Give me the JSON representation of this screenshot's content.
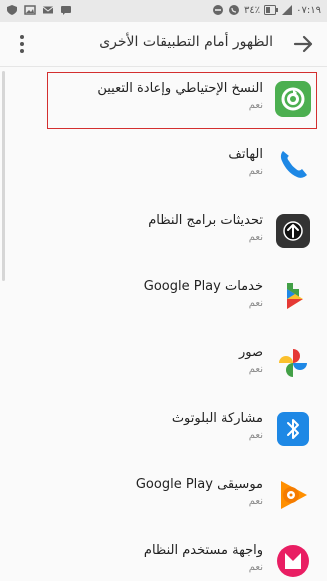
{
  "status_bar": {
    "time": "٠٧:١٩",
    "battery": "٣٤٪"
  },
  "app_bar": {
    "title": "الظهور أمام التطبيقات الأخرى"
  },
  "items": [
    {
      "label": "النسخ الإحتياطي وإعادة التعيين",
      "sub": "نعم",
      "icon": "backup-restore-icon"
    },
    {
      "label": "الهاتف",
      "sub": "نعم",
      "icon": "phone-icon"
    },
    {
      "label": "تحديثات برامج النظام",
      "sub": "نعم",
      "icon": "system-update-icon"
    },
    {
      "label": "خدمات Google Play",
      "sub": "نعم",
      "icon": "google-play-services-icon"
    },
    {
      "label": "صور",
      "sub": "نعم",
      "icon": "photos-icon"
    },
    {
      "label": "مشاركة البلوتوث",
      "sub": "نعم",
      "icon": "bluetooth-icon"
    },
    {
      "label": "موسيقى Google Play",
      "sub": "نعم",
      "icon": "google-play-music-icon"
    },
    {
      "label": "واجهة مستخدم النظام",
      "sub": "نعم",
      "icon": "system-ui-icon"
    }
  ]
}
